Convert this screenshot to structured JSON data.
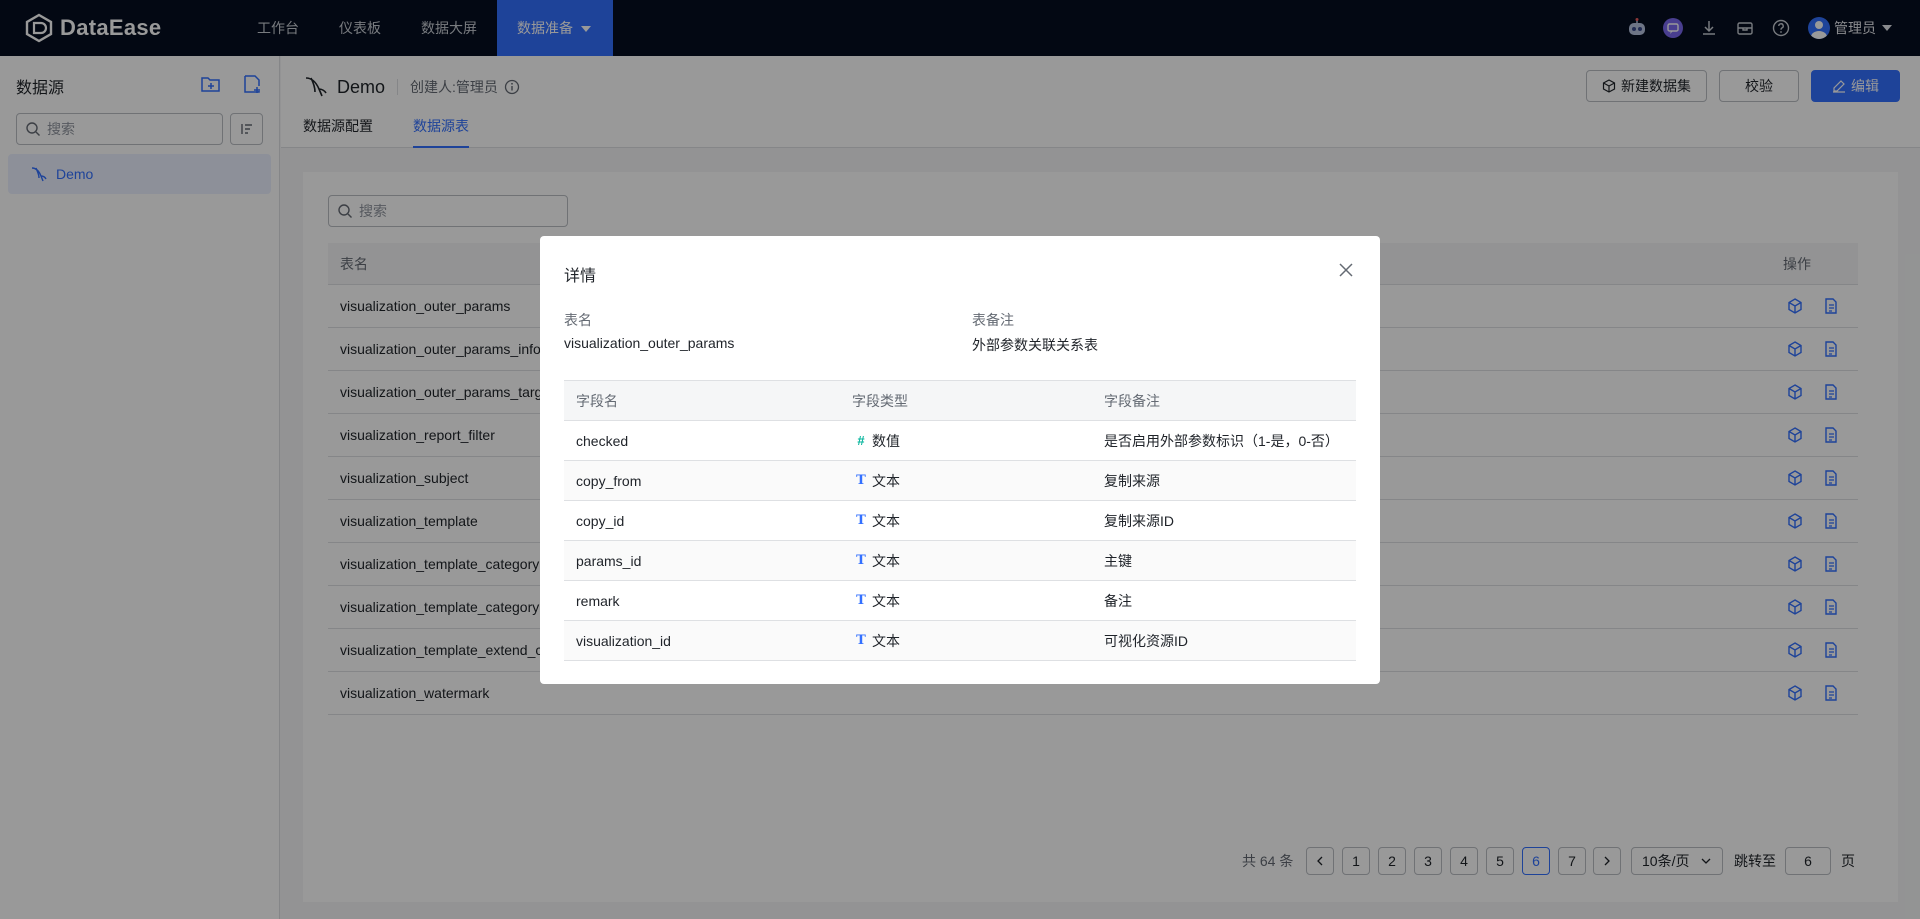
{
  "nav": {
    "logo": "DataEase",
    "menu": [
      "工作台",
      "仪表板",
      "数据大屏",
      "数据准备"
    ],
    "user": "管理员"
  },
  "sidebar": {
    "title": "数据源",
    "search_placeholder": "搜索",
    "items": [
      {
        "label": "Demo"
      }
    ]
  },
  "header": {
    "ds_name": "Demo",
    "creator": "创建人:管理员",
    "tabs": [
      "数据源配置",
      "数据源表"
    ],
    "buttons": {
      "new_dataset": "新建数据集",
      "validate": "校验",
      "edit": "编辑"
    }
  },
  "table": {
    "search_placeholder": "搜索",
    "col_name": "表名",
    "col_ops": "操作",
    "rows": [
      "visualization_outer_params",
      "visualization_outer_params_info",
      "visualization_outer_params_targ",
      "visualization_report_filter",
      "visualization_subject",
      "visualization_template",
      "visualization_template_category",
      "visualization_template_category",
      "visualization_template_extend_c",
      "visualization_watermark"
    ]
  },
  "pagination": {
    "total": "共 64 条",
    "pages": [
      "1",
      "2",
      "3",
      "4",
      "5",
      "6",
      "7"
    ],
    "current": "6",
    "page_size": "10条/页",
    "jump_label": "跳转至",
    "jump_value": "6",
    "jump_unit": "页"
  },
  "modal": {
    "title": "详情",
    "table_name_label": "表名",
    "table_name": "visualization_outer_params",
    "remark_label": "表备注",
    "remark": "外部参数关联关系表",
    "columns": {
      "name": "字段名",
      "type": "字段类型",
      "remark": "字段备注"
    },
    "fields": [
      {
        "name": "checked",
        "type": "数值",
        "type_icon": "#",
        "remark": "是否启用外部参数标识（1-是，0-否）"
      },
      {
        "name": "copy_from",
        "type": "文本",
        "type_icon": "T",
        "remark": "复制来源"
      },
      {
        "name": "copy_id",
        "type": "文本",
        "type_icon": "T",
        "remark": "复制来源ID"
      },
      {
        "name": "params_id",
        "type": "文本",
        "type_icon": "T",
        "remark": "主键"
      },
      {
        "name": "remark",
        "type": "文本",
        "type_icon": "T",
        "remark": "备注"
      },
      {
        "name": "visualization_id",
        "type": "文本",
        "type_icon": "T",
        "remark": "可视化资源ID"
      }
    ]
  },
  "colors": {
    "primary": "#3370ff",
    "nav_bg": "#050e21",
    "number_type": "#04b49c"
  }
}
